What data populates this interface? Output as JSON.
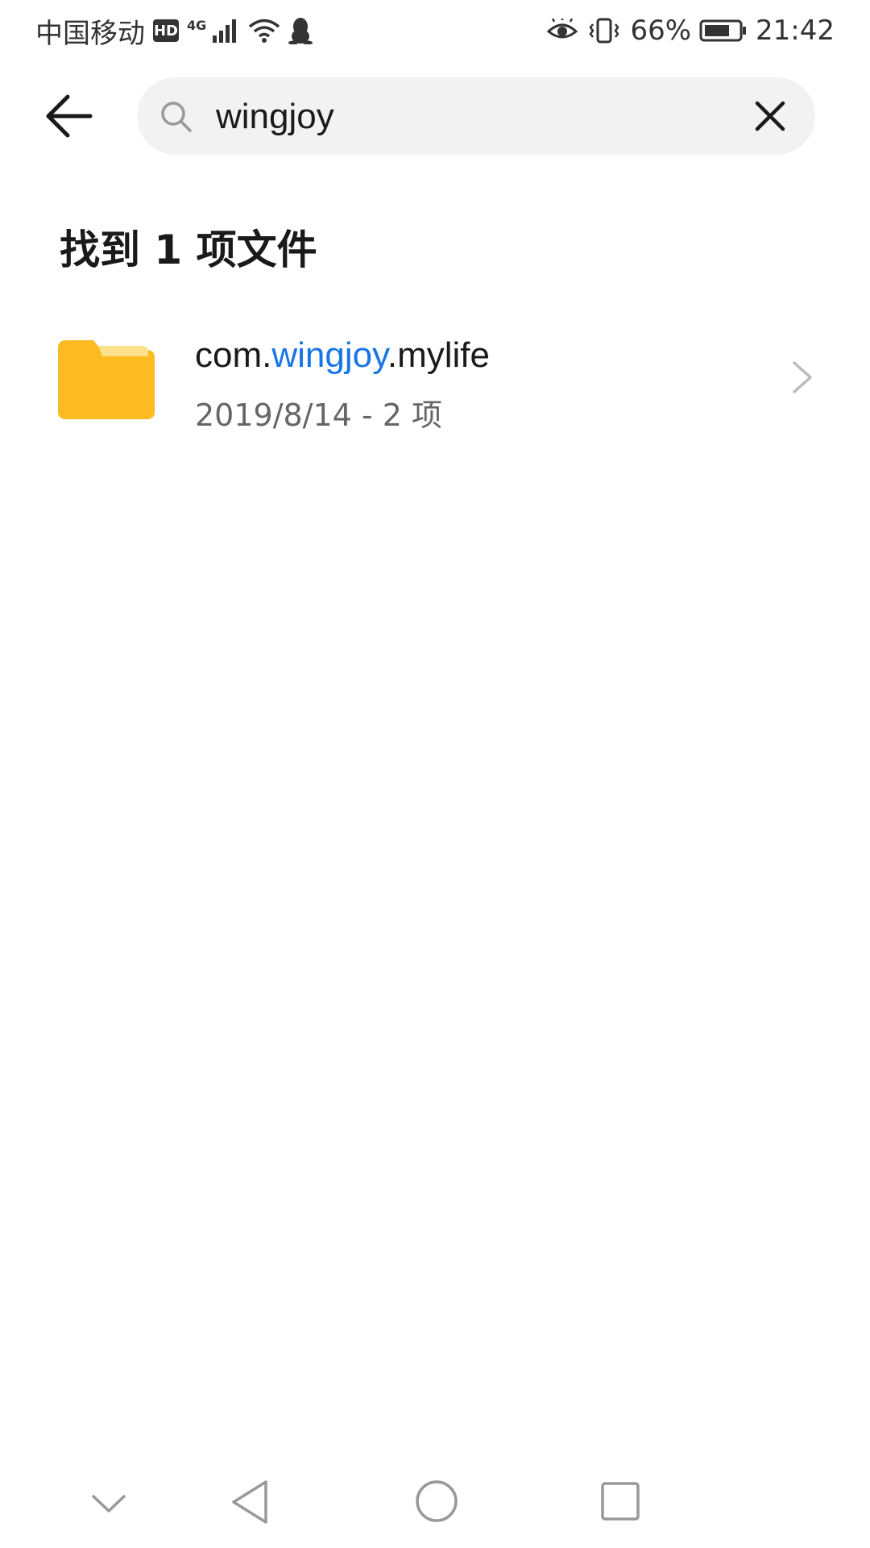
{
  "status_bar": {
    "carrier": "中国移动",
    "hd": "HD",
    "network": "4G",
    "battery_percent": "66%",
    "time": "21:42"
  },
  "search": {
    "query": "wingjoy"
  },
  "results": {
    "heading": "找到 1 项文件",
    "items": [
      {
        "title_prefix": "com.",
        "title_highlight": "wingjoy",
        "title_suffix": ".mylife",
        "meta": "2019/8/14 - 2 项"
      }
    ]
  },
  "colors": {
    "highlight": "#1875e6",
    "folder": "#fbbb21",
    "folder_tab": "#fde08a",
    "search_bg": "#f2f2f2"
  },
  "icons": {
    "back": "arrow-left-icon",
    "search": "search-icon",
    "clear": "close-icon",
    "folder": "folder-icon",
    "chevron": "chevron-right-icon"
  }
}
